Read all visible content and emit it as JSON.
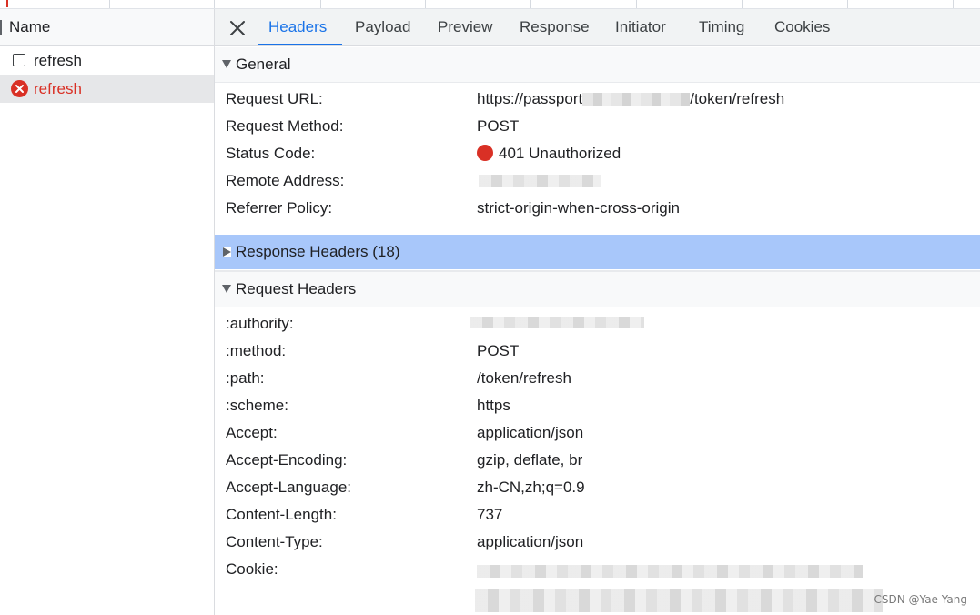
{
  "request_list": {
    "column_header": "Name",
    "items": [
      {
        "label": "refresh",
        "state": "normal"
      },
      {
        "label": "refresh",
        "state": "error"
      }
    ]
  },
  "tabs": [
    {
      "label": "Headers",
      "active": true
    },
    {
      "label": "Payload",
      "active": false
    },
    {
      "label": "Preview",
      "active": false
    },
    {
      "label": "Response",
      "active": false
    },
    {
      "label": "Initiator",
      "active": false
    },
    {
      "label": "Timing",
      "active": false
    },
    {
      "label": "Cookies",
      "active": false
    }
  ],
  "general": {
    "title": "General",
    "rows": [
      {
        "key": "Request URL:",
        "value_start": "https://passport",
        "value_end": "/token/refresh"
      },
      {
        "key": "Request Method:",
        "value": "POST"
      },
      {
        "key": "Status Code:",
        "value": "401 Unauthorized"
      },
      {
        "key": "Remote Address:",
        "value": ""
      },
      {
        "key": "Referrer Policy:",
        "value": "strict-origin-when-cross-origin"
      }
    ]
  },
  "response_headers": {
    "title": "Response Headers (18)"
  },
  "request_headers": {
    "title": "Request Headers",
    "rows": [
      {
        "key": ":authority:",
        "value": ""
      },
      {
        "key": ":method:",
        "value": "POST"
      },
      {
        "key": ":path:",
        "value": "/token/refresh"
      },
      {
        "key": ":scheme:",
        "value": "https"
      },
      {
        "key": "Accept:",
        "value": "application/json"
      },
      {
        "key": "Accept-Encoding:",
        "value": "gzip, deflate, br"
      },
      {
        "key": "Accept-Language:",
        "value": "zh-CN,zh;q=0.9"
      },
      {
        "key": "Content-Length:",
        "value": "737"
      },
      {
        "key": "Content-Type:",
        "value": "application/json"
      },
      {
        "key": "Cookie:",
        "value": ""
      }
    ]
  },
  "colors": {
    "accent": "#1a73e8",
    "error": "#d93025",
    "selected_section": "#a8c7fa"
  },
  "watermark": "CSDN @Yae Yang"
}
